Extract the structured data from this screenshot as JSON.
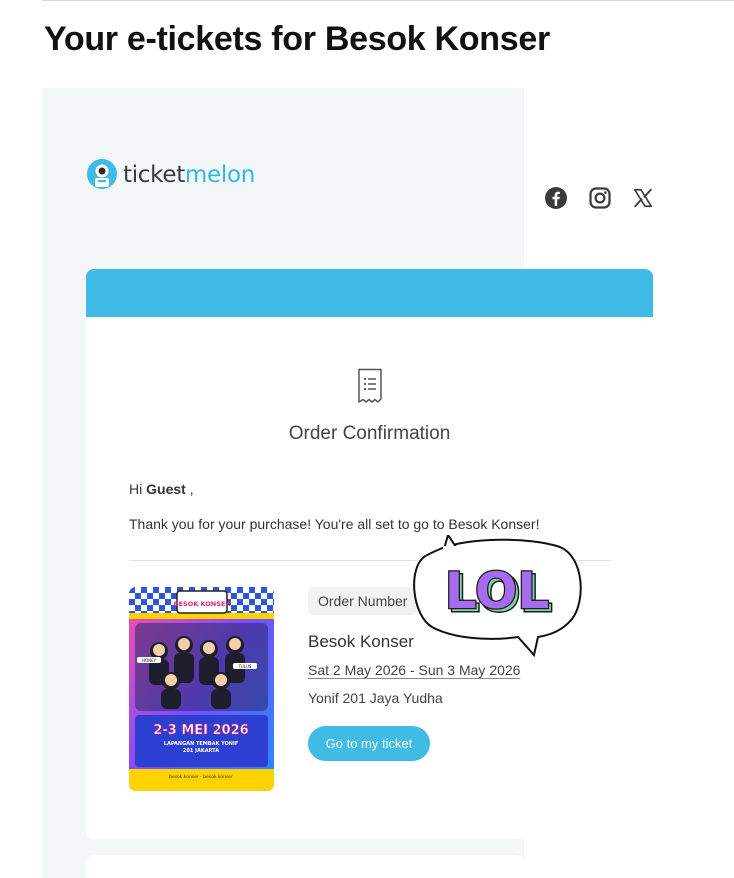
{
  "email": {
    "heading": "Your e-tickets for Besok Konser"
  },
  "brand": {
    "name_part1": "ticket",
    "name_part2": "melon",
    "accent_color": "#40bbe6"
  },
  "social_icons": [
    "facebook-icon",
    "instagram-icon",
    "x-icon"
  ],
  "card": {
    "title": "Order Confirmation",
    "greeting_prefix": "Hi ",
    "greeting_name": "Guest",
    "greeting_suffix": " ,",
    "thanks_message": "Thank you for your purchase! You're all set to go to Besok Konser!",
    "order_number_label": "Order Number",
    "event_name": "Besok Konser",
    "event_date": "Sat 2 May 2026 - Sun 3 May 2026",
    "venue": "Yonif 201 Jaya Yudha",
    "button_label": "Go to my ticket"
  },
  "poster": {
    "top_title": "BESOK KONSER",
    "dates": "2-3 MEI 2026",
    "venue_line1": "LAPANGAN TEMBAK YONIF",
    "venue_line2": "201 JAKARTA",
    "artist_tags": [
      "HONEY",
      "",
      "TULUS",
      "",
      "",
      "",
      ""
    ],
    "footer": "besok.konser · besok.konser"
  },
  "sticker": {
    "text": "LOL"
  }
}
